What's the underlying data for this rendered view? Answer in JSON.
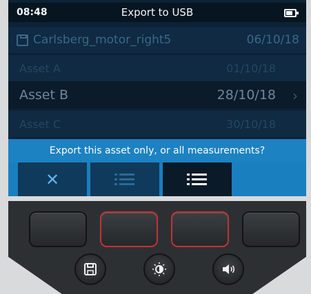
{
  "status_bar": {
    "time": "08:48",
    "title": "Export to USB",
    "battery_icon": "battery-icon"
  },
  "file_header": {
    "icon": "save-icon",
    "name": "Carlsberg_motor_right5",
    "date": "06/10/18"
  },
  "assets": [
    {
      "label": "Asset A",
      "date": "01/10/18"
    },
    {
      "label": "Asset B",
      "date": "28/10/18",
      "chevron": "›"
    },
    {
      "label": "Asset C",
      "date": "30/10/18"
    }
  ],
  "prompt": "Export this asset only, or all measurements?",
  "softkeys": [
    {
      "icon": "close-icon",
      "glyph": "✕"
    },
    {
      "icon": "list-icon"
    },
    {
      "icon": "list-all-icon"
    },
    {
      "icon": "empty"
    }
  ],
  "hardware_buttons": {
    "soft_keys": [
      "softkey-1",
      "softkey-2",
      "softkey-3",
      "softkey-4"
    ],
    "round_keys": [
      "save-icon",
      "brightness-icon",
      "volume-icon"
    ]
  },
  "colors": {
    "accent": "#1c82c2",
    "screen_bg": "#0c2235",
    "highlight_border": "#c33236"
  }
}
